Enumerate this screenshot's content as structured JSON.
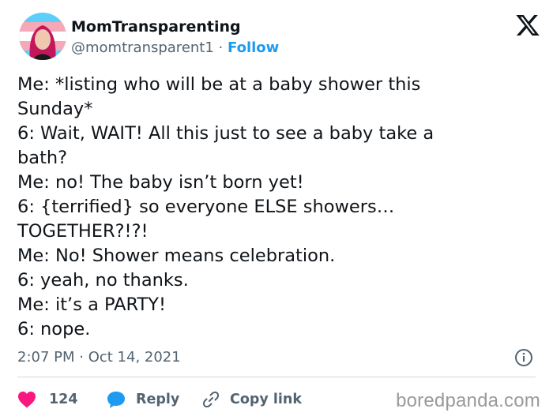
{
  "author": {
    "display_name": "MomTransparenting",
    "handle": "@momtransparent1",
    "separator": "·",
    "follow_label": "Follow"
  },
  "tweet": {
    "lines": [
      "Me: *listing who will be at a baby shower this",
      "Sunday*",
      "6: Wait, WAIT! All this just to see a baby take a",
      "bath?",
      "Me: no! The baby isn’t born yet!",
      "6: {terrified} so everyone ELSE showers…",
      "TOGETHER?!?!",
      "Me: No! Shower means celebration.",
      "6: yeah, no thanks.",
      "Me: it’s a PARTY!",
      "6: nope."
    ],
    "timestamp": "2:07 PM · Oct 14, 2021"
  },
  "actions": {
    "like_count": "124",
    "reply_label": "Reply",
    "copy_link_label": "Copy link"
  },
  "watermark": "boredpanda.com",
  "colors": {
    "text": "#0f1419",
    "secondary": "#536471",
    "accent": "#1d9bf0",
    "like": "#f91880",
    "divider": "#cfd9de"
  },
  "icons": {
    "platform": "x-logo-icon",
    "info": "info-icon",
    "like": "heart-icon",
    "reply": "speech-bubble-icon",
    "copy": "link-icon"
  }
}
